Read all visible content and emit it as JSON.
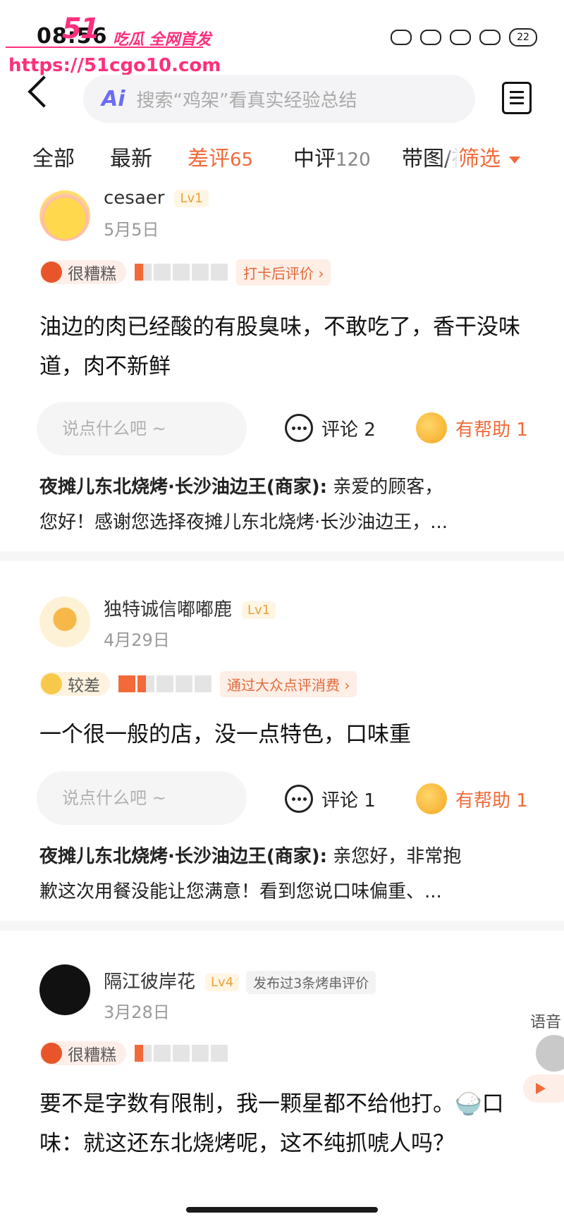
{
  "status_bar": {
    "time": "08:56",
    "battery": "22"
  },
  "watermark": {
    "logo": "51",
    "tagline": "吃瓜 全网首发",
    "url": "https://51cgo10.com"
  },
  "header": {
    "search_placeholder": "搜索“鸡架”看真实经验总结",
    "ai_label": "Ai"
  },
  "tabs": [
    {
      "label": "全部",
      "count": ""
    },
    {
      "label": "最新",
      "count": ""
    },
    {
      "label": "差评",
      "count": "65"
    },
    {
      "label": "中评",
      "count": "120"
    },
    {
      "label": "带图/视",
      "count": ""
    }
  ],
  "filter_label": "筛选",
  "reviews": [
    {
      "user": "cesaer",
      "level": "Lv1",
      "badge": "",
      "date": "5月5日",
      "mood": "很糟糕",
      "rating": 1,
      "source": "打卡后评价 ›",
      "text": "油边的肉已经酸的有股臭味，不敢吃了，香干没味道，肉不新鲜",
      "comment_placeholder": "说点什么吧 ~",
      "comment_label": "评论 2",
      "helpful_label": "有帮助 1",
      "reply_merchant": "夜摊儿东北烧烤·长沙油边王(商家):",
      "reply_line1": " 亲爱的顾客，",
      "reply_line2": "您好！感谢您选择夜摊儿东北烧烤·长沙油边王，..."
    },
    {
      "user": "独特诚信嘟嘟鹿",
      "level": "Lv1",
      "badge": "",
      "date": "4月29日",
      "mood": "较差",
      "rating": 2,
      "source": "通过大众点评消费 ›",
      "text": "一个很一般的店，没一点特色，口味重",
      "comment_placeholder": "说点什么吧 ~",
      "comment_label": "评论 1",
      "helpful_label": "有帮助 1",
      "reply_merchant": "夜摊儿东北烧烤·长沙油边王(商家):",
      "reply_line1": " 亲您好，非常抱",
      "reply_line2": "歉这次用餐没能让您满意！看到您说口味偏重、..."
    },
    {
      "user": "隔江彼岸花",
      "level": "Lv4",
      "badge": "发布过3条烤串评价",
      "date": "3月28日",
      "mood": "很糟糕",
      "rating": 1,
      "source": "",
      "text": "要不是字数有限制，我一颗星都不给他打。🍚口味：就这还东北烧烤呢，这不纯抓唬人吗？"
    }
  ],
  "side_widget": {
    "label": "语音"
  },
  "colors": {
    "accent": "#f26a3a",
    "watermark": "#ff2f7d",
    "ai": "#6b6cf6"
  }
}
